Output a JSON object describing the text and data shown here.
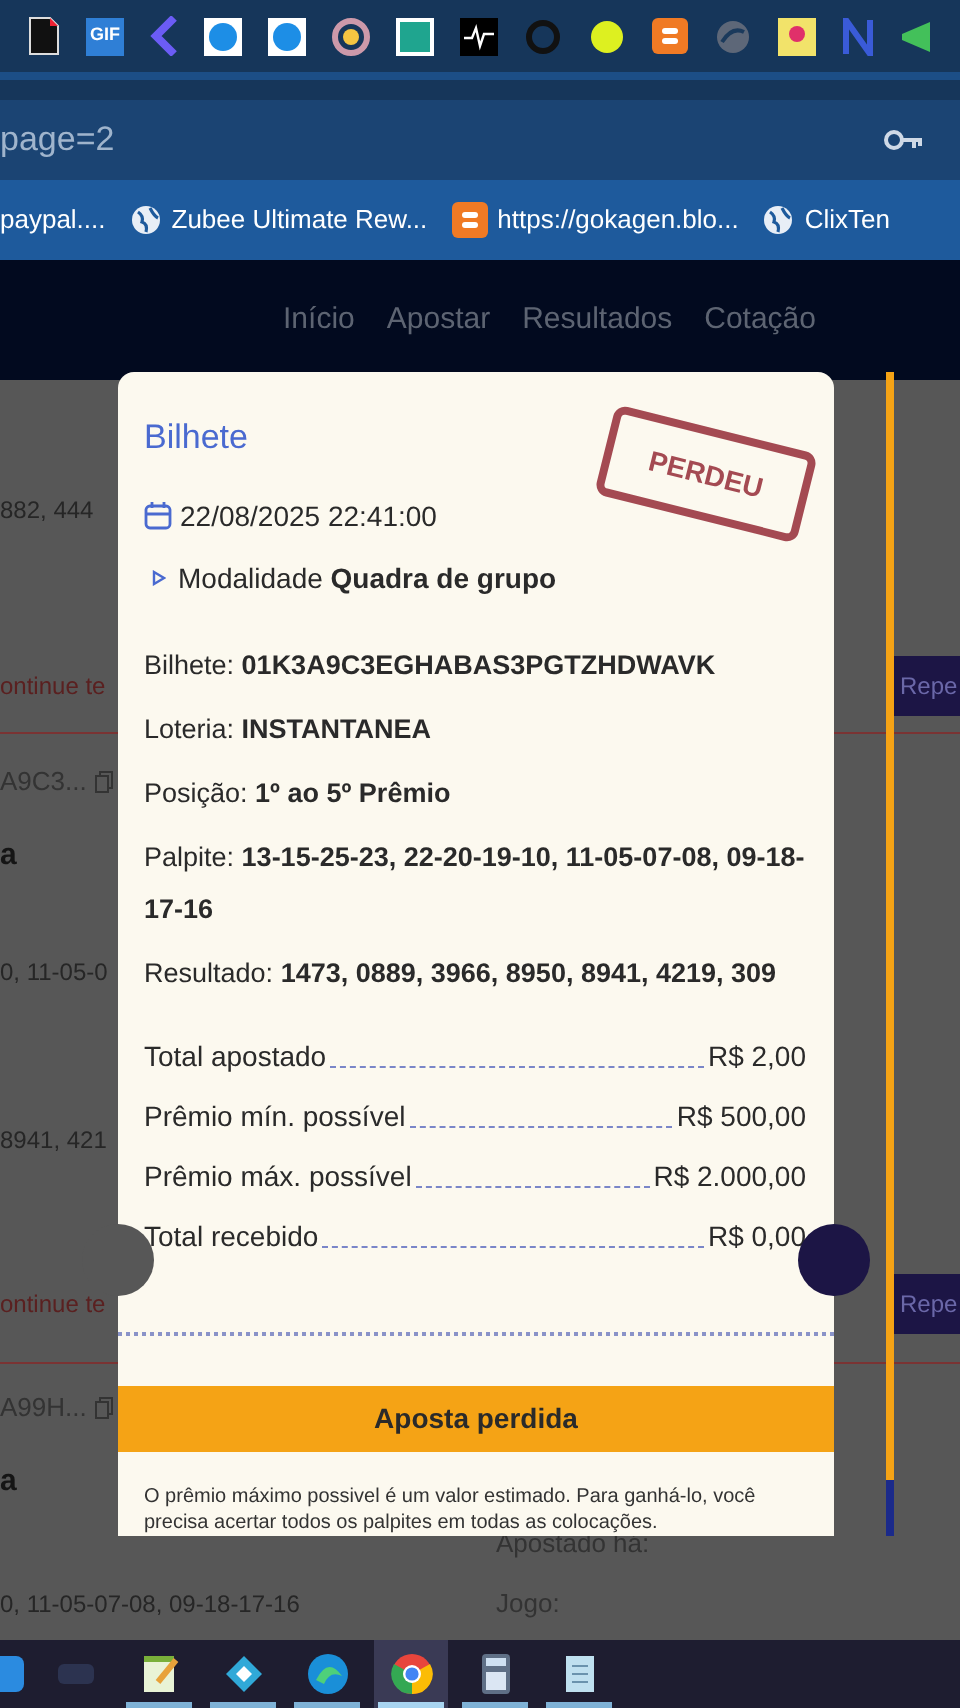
{
  "extensions_bar": {
    "gif_label": "GIF"
  },
  "address_bar": {
    "url": "page=2"
  },
  "bookmarks": [
    {
      "label": "paypal....",
      "kind": "none"
    },
    {
      "label": "Zubee Ultimate Rew...",
      "kind": "globe"
    },
    {
      "label": "https://gokagen.blo...",
      "kind": "blogger"
    },
    {
      "label": "ClixTen",
      "kind": "globe"
    }
  ],
  "site_nav": [
    "Início",
    "Apostar",
    "Resultados",
    "Cotação"
  ],
  "background": {
    "row_1": "882, 444",
    "continue_1": "ontinue te",
    "edit_1": "Repe",
    "id_1": "A9C3...",
    "title_1": "a",
    "guess_1": "0, 11-05-0",
    "result_1": "8941, 421",
    "continue_2": "ontinue te",
    "edit_2": "Repe",
    "id_2": "A99H...",
    "title_2": "a",
    "guess_2": "0, 11-05-07-08, 09-18-17-16",
    "bet_ago": "Apostado há:",
    "game": "Jogo:"
  },
  "modal": {
    "title": "Bilhete",
    "stamp": "PERDEU",
    "date": "22/08/2025 22:41:00",
    "mode_label": "Modalidade",
    "mode_value": "Quadra de grupo",
    "fields": [
      {
        "label": "Bilhete:",
        "value": "01K3A9C3EGHABAS3PGTZHDWAVK"
      },
      {
        "label": "Loteria:",
        "value": "INSTANTANEA"
      },
      {
        "label": "Posição:",
        "value": "1º ao 5º Prêmio"
      },
      {
        "label": "Palpite:",
        "value": "13-15-25-23, 22-20-19-10, 11-05-07-08, 09-18-17-16"
      },
      {
        "label": "Resultado:",
        "value": "1473, 0889, 3966, 8950, 8941, 4219, 309"
      }
    ],
    "totals": [
      {
        "label": "Total apostado",
        "value": "R$ 2,00"
      },
      {
        "label": "Prêmio mín. possível",
        "value": "R$ 500,00"
      },
      {
        "label": "Prêmio máx. possível",
        "value": "R$ 2.000,00"
      },
      {
        "label": "Total recebido",
        "value": "R$ 0,00"
      }
    ],
    "status": "Aposta perdida",
    "note": "O prêmio máximo possivel é um valor estimado. Para ganhá-lo, você precisa acertar todos os palpites em todas as colocações."
  },
  "taskbar": [
    {
      "kind": "blue",
      "selected": false
    },
    {
      "kind": "faint",
      "selected": false
    },
    {
      "kind": "notepad",
      "selected": false
    },
    {
      "kind": "kodi",
      "selected": false
    },
    {
      "kind": "edge",
      "selected": false
    },
    {
      "kind": "chrome",
      "selected": true
    },
    {
      "kind": "calculator",
      "selected": false
    },
    {
      "kind": "notes",
      "selected": false
    }
  ]
}
